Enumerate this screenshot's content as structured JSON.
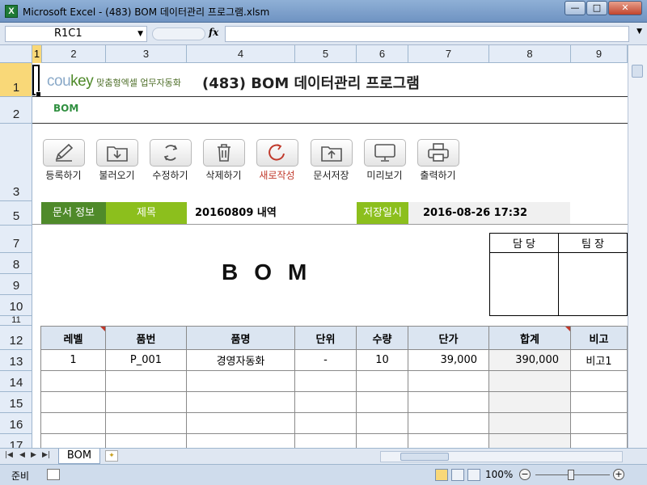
{
  "window": {
    "title": "Microsoft Excel - (483) BOM 데이터관리 프로그램.xlsm",
    "app_icon": "X",
    "buttons": {
      "minimize": "—",
      "maximize": "□",
      "close": "✕"
    }
  },
  "formula_bar": {
    "name_box": "R1C1",
    "fx_label": "fx",
    "formula": ""
  },
  "columns": [
    {
      "label": "1",
      "selected": true
    },
    {
      "label": "2"
    },
    {
      "label": "3"
    },
    {
      "label": "4"
    },
    {
      "label": "5"
    },
    {
      "label": "6"
    },
    {
      "label": "7"
    },
    {
      "label": "8"
    },
    {
      "label": "9"
    }
  ],
  "rows": [
    "1",
    "2",
    "3",
    "5",
    "7",
    "8",
    "9",
    "10",
    "11",
    "12",
    "13",
    "14",
    "15",
    "16",
    "17"
  ],
  "brand": {
    "logo_part1": "cou",
    "logo_part2": "key",
    "tagline": "맞춤형엑셀 업무자동화"
  },
  "doc_title": "(483) BOM 데이터관리 프로그램",
  "sheet_label": "BOM",
  "toolbar": [
    {
      "label": "등록하기",
      "icon": "pencil-icon"
    },
    {
      "label": "불러오기",
      "icon": "folder-download-icon"
    },
    {
      "label": "수정하기",
      "icon": "refresh-icon"
    },
    {
      "label": "삭제하기",
      "icon": "trash-icon"
    },
    {
      "label": "새로작성",
      "icon": "new-cycle-icon",
      "color": "#c0392b"
    },
    {
      "label": "문서저장",
      "icon": "folder-upload-icon"
    },
    {
      "label": "미리보기",
      "icon": "monitor-icon"
    },
    {
      "label": "출력하기",
      "icon": "printer-icon"
    }
  ],
  "info": {
    "doc_info_label": "문서 정보",
    "subject_label": "제목",
    "subject_value": "20160809 내역",
    "saved_label": "저장일시",
    "saved_value": "2016-08-26 17:32"
  },
  "bom_title": "BOM",
  "approval": {
    "col1": "담 당",
    "col2": "팀 장"
  },
  "table": {
    "headers": [
      "레벨",
      "품번",
      "품명",
      "단위",
      "수량",
      "단가",
      "합계",
      "비고"
    ],
    "rows": [
      [
        "1",
        "P_001",
        "경영자동화",
        "-",
        "10",
        "39,000",
        "390,000",
        "비고1"
      ],
      [
        "",
        "",
        "",
        "",
        "",
        "",
        "",
        ""
      ],
      [
        "",
        "",
        "",
        "",
        "",
        "",
        "",
        ""
      ],
      [
        "",
        "",
        "",
        "",
        "",
        "",
        "",
        ""
      ],
      [
        "",
        "",
        "",
        "",
        "",
        "",
        "",
        ""
      ]
    ]
  },
  "tabs": {
    "active": "BOM"
  },
  "status": {
    "mode": "준비",
    "zoom": "100%"
  },
  "colors": {
    "accent_dark": "#4f8a2a",
    "accent_light": "#8cbf1d",
    "header_blue": "#dbe5f1"
  }
}
